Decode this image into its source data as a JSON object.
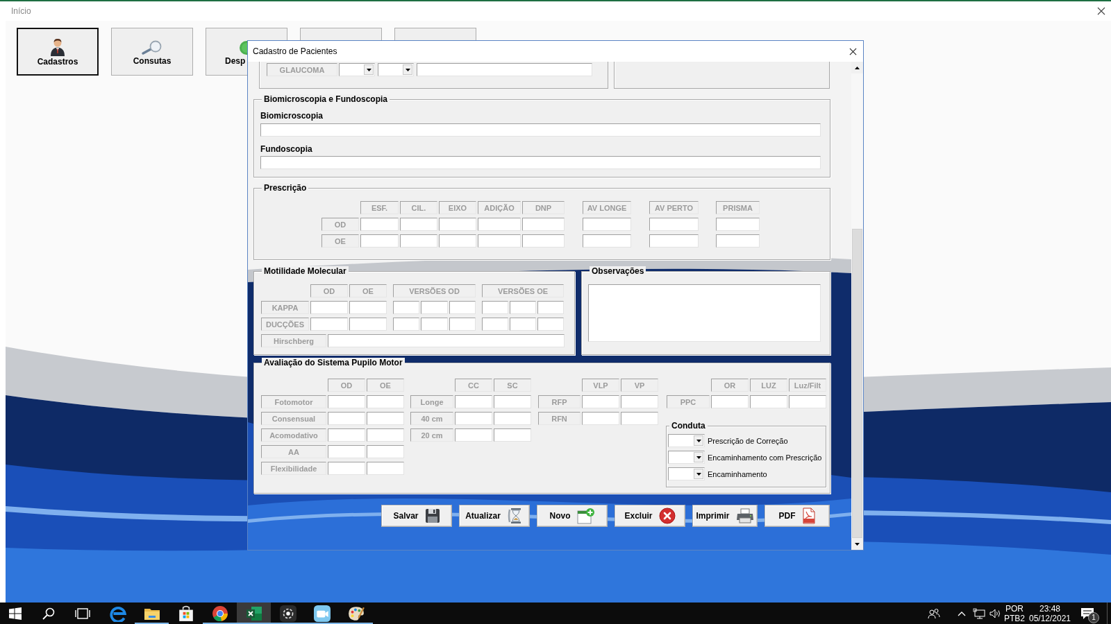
{
  "window": {
    "title": "Início"
  },
  "menu_tiles": [
    {
      "label": "Cadastros",
      "selected": true
    },
    {
      "label": "Consutas",
      "selected": false
    },
    {
      "label": "Desp",
      "selected": false
    },
    {
      "selected": false
    },
    {
      "selected": false
    }
  ],
  "dialog": {
    "title": "Cadastro de Pacientes",
    "glaucoma_row": {
      "label": "GLAUCOMA"
    },
    "biomicroscopia": {
      "title": "Biomicroscopia e Fundoscopia",
      "fields": [
        {
          "label": "Biomicroscopia"
        },
        {
          "label": "Fundoscopia"
        }
      ]
    },
    "prescricao": {
      "title": "Prescrição",
      "columns": [
        "ESF.",
        "CIL.",
        "EIXO",
        "ADIÇÃO",
        "DNP",
        "AV LONGE",
        "AV PERTO",
        "PRISMA"
      ],
      "rows": [
        "OD",
        "OE"
      ]
    },
    "motilidade": {
      "title": "Motilidade Molecular",
      "columns": [
        "OD",
        "OE",
        "VERSÕES OD",
        "VERSÕES OE"
      ],
      "rows": [
        {
          "label": "KAPPA",
          "kind": "grid"
        },
        {
          "label": "DUCÇÕES",
          "kind": "grid"
        },
        {
          "label": "Hirschberg",
          "kind": "wide"
        }
      ]
    },
    "observacoes": {
      "title": "Observações"
    },
    "pupilo_motor": {
      "title": "Avaliação do Sistema Pupilo Motor",
      "tables": [
        {
          "columns": [
            "OD",
            "OE"
          ],
          "rows": [
            "Fotomotor",
            "Consensual",
            "Acomodativo",
            "AA",
            "Flexibilidade"
          ]
        },
        {
          "columns": [
            "CC",
            "SC"
          ],
          "rows": [
            "Longe",
            "40 cm",
            "20 cm"
          ]
        },
        {
          "columns": [
            "VLP",
            "VP"
          ],
          "rows": [
            "RFP",
            "RFN"
          ]
        },
        {
          "columns": [
            "OR",
            "LUZ",
            "Luz/Filt"
          ],
          "rows": [
            "PPC"
          ]
        }
      ],
      "conduta": {
        "title": "Conduta",
        "items": [
          "Prescrição de Correção",
          "Encaminhamento com Prescrição",
          "Encaminhamento"
        ]
      }
    },
    "buttons": [
      "Salvar",
      "Atualizar",
      "Novo",
      "Excluir",
      "Imprimir",
      "PDF"
    ]
  },
  "taskbar": {
    "apps": [
      {
        "running": false,
        "active": false
      },
      {
        "running": true,
        "active": false
      },
      {
        "running": false,
        "active": false
      },
      {
        "running": true,
        "active": false
      },
      {
        "running": true,
        "active": true
      },
      {
        "running": true,
        "active": false
      },
      {
        "running": true,
        "active": false
      },
      {
        "running": true,
        "active": false
      }
    ],
    "language": "POR",
    "layout": "PTB2",
    "time": "23:48",
    "date": "05/12/2021",
    "notification_count": "1"
  }
}
